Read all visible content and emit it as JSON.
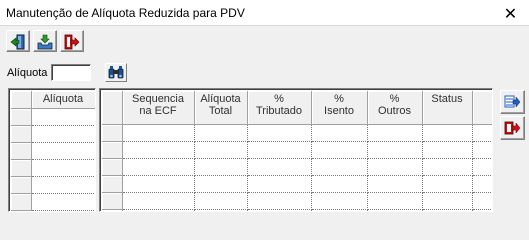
{
  "window": {
    "title": "Manutenção de Alíquota Reduzida para PDV",
    "close_glyph": "✕"
  },
  "toolbar": {
    "buttons": [
      {
        "name": "exit-door-icon"
      },
      {
        "name": "save-tray-icon"
      },
      {
        "name": "exit-arrow-icon"
      }
    ]
  },
  "filter": {
    "label": "Alíquota",
    "value": "",
    "search_icon": "binoculars-icon"
  },
  "left_grid": {
    "header": "Alíquota",
    "row_count": 6
  },
  "main_grid": {
    "headers": [
      "Sequencia\nna ECF",
      "Alíquota\nTotal",
      "%\nTributado",
      "%\nIsento",
      "%\nOutros",
      "Status"
    ],
    "row_count": 6
  },
  "side_buttons": [
    {
      "name": "add-record-icon"
    },
    {
      "name": "remove-record-icon"
    }
  ],
  "colors": {
    "background": "#f0f0f0",
    "grid_background": "#ffffff",
    "accent_red": "#d01010",
    "accent_blue": "#1f5fbf"
  }
}
